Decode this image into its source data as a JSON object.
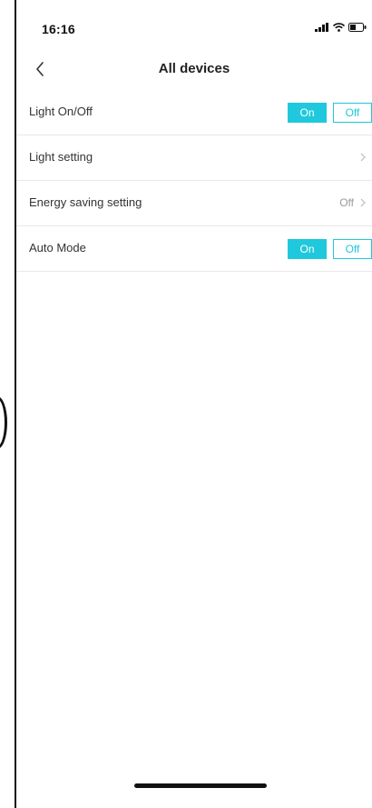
{
  "status_bar": {
    "time": "16:16",
    "icons": [
      "signal-icon",
      "wifi-icon",
      "battery-icon"
    ]
  },
  "nav": {
    "title": "All devices",
    "back_icon": "chevron-left-icon"
  },
  "rows": [
    {
      "label": "Light On/Off",
      "type": "toggle",
      "on_label": "On",
      "off_label": "Off",
      "selected": "On"
    },
    {
      "label": "Light setting",
      "type": "link"
    },
    {
      "label": "Energy saving setting",
      "type": "link",
      "value": "Off"
    },
    {
      "label": "Auto Mode",
      "type": "toggle",
      "on_label": "On",
      "off_label": "Off",
      "selected": "On"
    }
  ],
  "colors": {
    "accent": "#1fc8dc",
    "divider": "#e8e8e8",
    "text": "#333333",
    "muted": "#999999"
  }
}
